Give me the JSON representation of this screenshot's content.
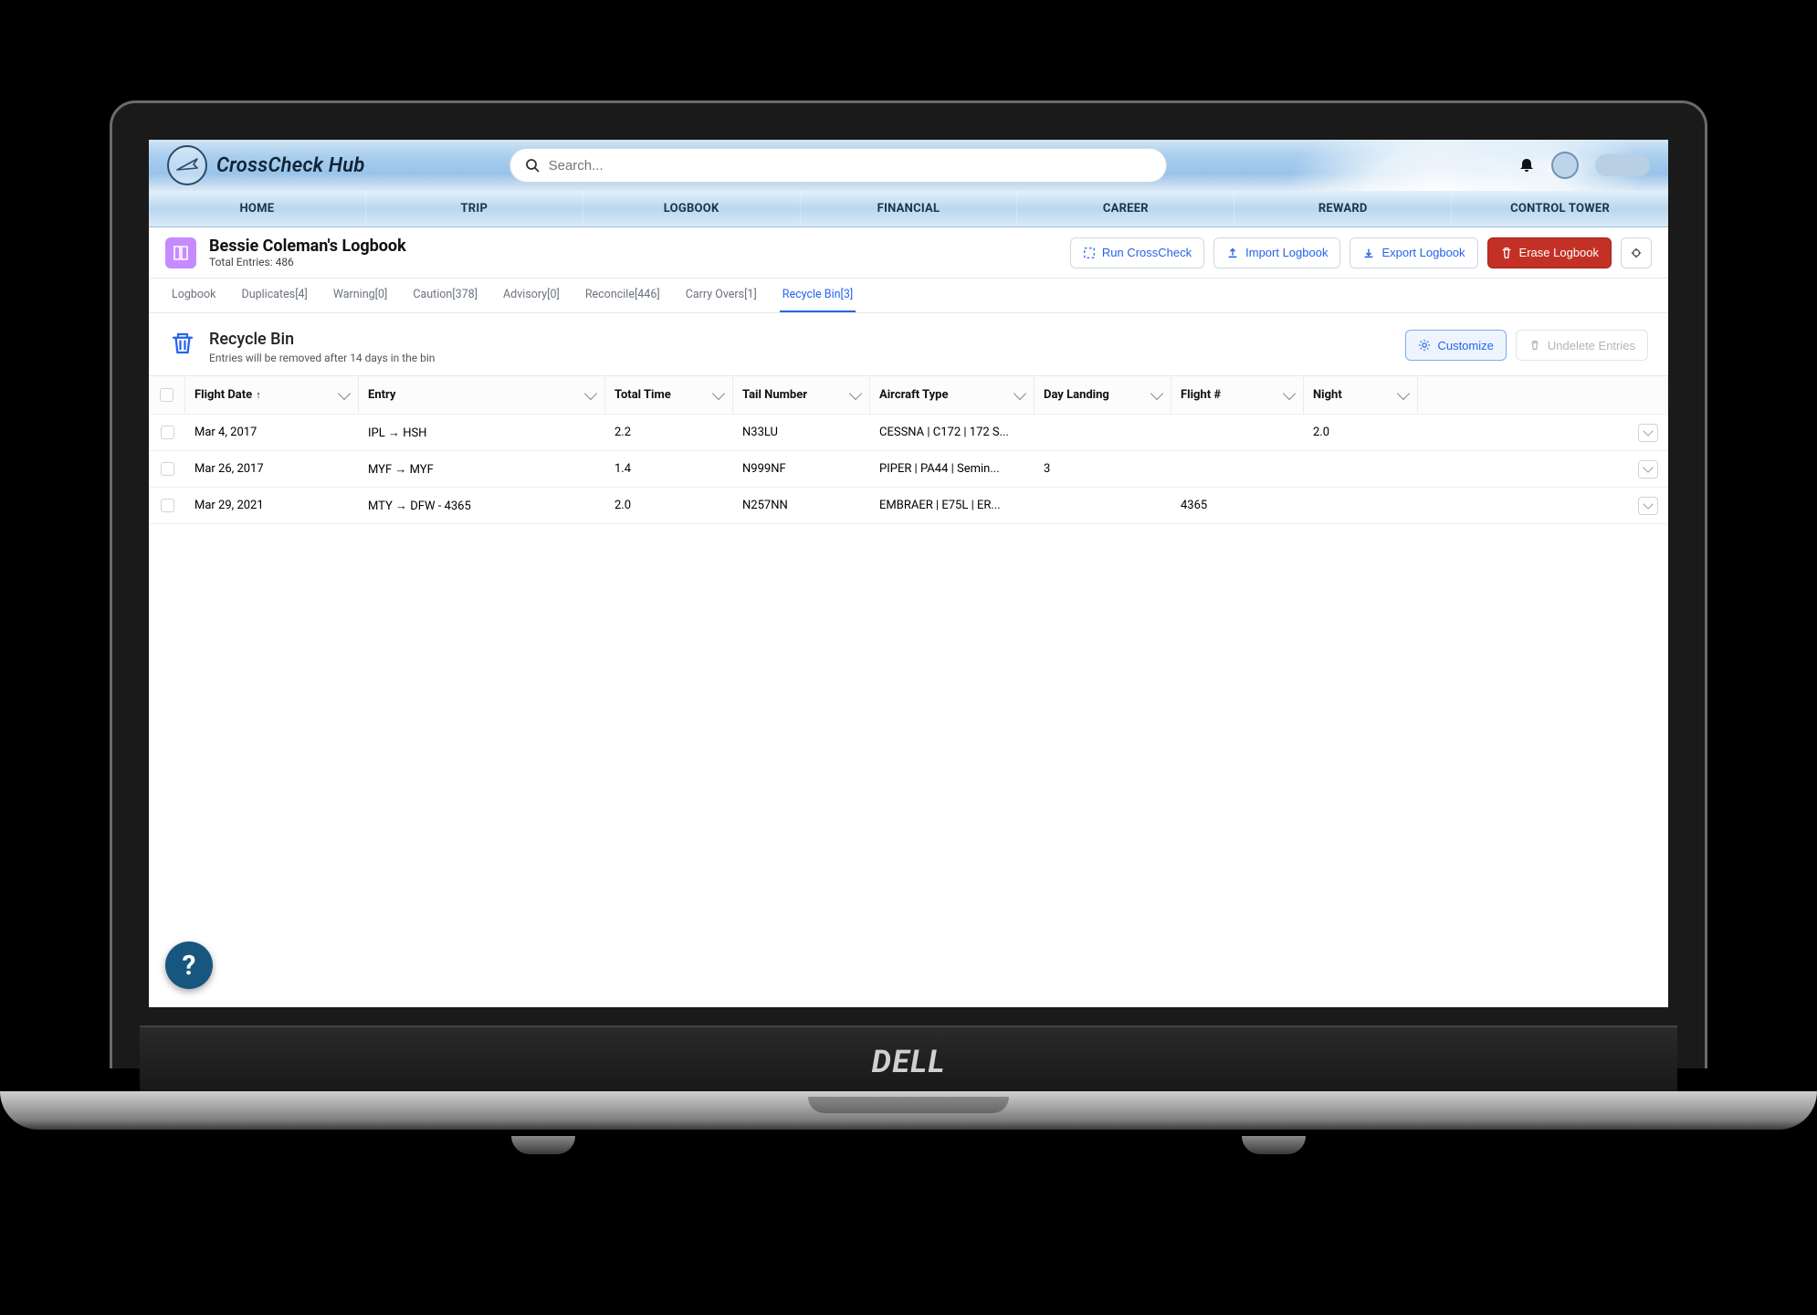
{
  "app": {
    "name": "CrossCheck Hub"
  },
  "search": {
    "placeholder": "Search..."
  },
  "nav": [
    "HOME",
    "TRIP",
    "LOGBOOK",
    "FINANCIAL",
    "CAREER",
    "REWARD",
    "CONTROL TOWER"
  ],
  "page": {
    "title": "Bessie Coleman's Logbook",
    "subtitle": "Total Entries: 486"
  },
  "actions": {
    "run": "Run CrossCheck",
    "import": "Import Logbook",
    "export": "Export Logbook",
    "erase": "Erase Logbook"
  },
  "tabs": [
    {
      "label": "Logbook"
    },
    {
      "label": "Duplicates[4]"
    },
    {
      "label": "Warning[0]"
    },
    {
      "label": "Caution[378]"
    },
    {
      "label": "Advisory[0]"
    },
    {
      "label": "Reconcile[446]"
    },
    {
      "label": "Carry Overs[1]"
    },
    {
      "label": "Recycle Bin[3]"
    }
  ],
  "section": {
    "title": "Recycle Bin",
    "subtitle": "Entries will be removed after 14 days in the bin",
    "customize": "Customize",
    "undelete": "Undelete Entries"
  },
  "columns": {
    "flight_date": "Flight Date",
    "entry": "Entry",
    "total_time": "Total Time",
    "tail": "Tail Number",
    "type": "Aircraft Type",
    "day_landing": "Day Landing",
    "flight_no": "Flight #",
    "night": "Night"
  },
  "rows": [
    {
      "date": "Mar 4, 2017",
      "entry": "IPL → HSH",
      "time": "2.2",
      "tail": "N33LU",
      "type": "CESSNA | C172 | 172 S...",
      "daylnd": "",
      "flight": "",
      "night": "2.0"
    },
    {
      "date": "Mar 26, 2017",
      "entry": "MYF → MYF",
      "time": "1.4",
      "tail": "N999NF",
      "type": "PIPER | PA44 | Semin...",
      "daylnd": "3",
      "flight": "",
      "night": ""
    },
    {
      "date": "Mar 29, 2021",
      "entry": "MTY → DFW - 4365",
      "time": "2.0",
      "tail": "N257NN",
      "type": "EMBRAER | E75L | ER...",
      "daylnd": "",
      "flight": "4365",
      "night": ""
    }
  ],
  "device": {
    "brand": "DELL"
  }
}
